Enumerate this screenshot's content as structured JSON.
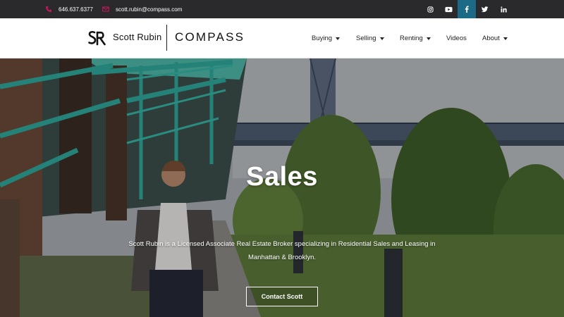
{
  "topbar": {
    "phone": "646.637.6377",
    "email": "scott.rubin@compass.com",
    "social": [
      "instagram-icon",
      "youtube-icon",
      "facebook-icon",
      "twitter-icon",
      "linkedin-icon"
    ],
    "active_social": "facebook-icon"
  },
  "header": {
    "logo_mark": "SR",
    "logo_name": "Scott Rubin",
    "logo_brand": "COMPASS",
    "nav": [
      {
        "label": "Buying",
        "dropdown": true
      },
      {
        "label": "Selling",
        "dropdown": true
      },
      {
        "label": "Renting",
        "dropdown": true
      },
      {
        "label": "Videos",
        "dropdown": false
      },
      {
        "label": "About",
        "dropdown": true
      }
    ]
  },
  "hero": {
    "title": "Sales",
    "description": "Scott Rubin is a Licensed Associate Real Estate Broker specializing in Residential Sales and Leasing in Manhattan & Brooklyn.",
    "cta": "Contact Scott"
  },
  "colors": {
    "topbar_bg": "#2a2a2c",
    "accent_pink": "#c2185b",
    "social_active": "#1d6a86",
    "bridge_teal": "#2aa79b"
  }
}
